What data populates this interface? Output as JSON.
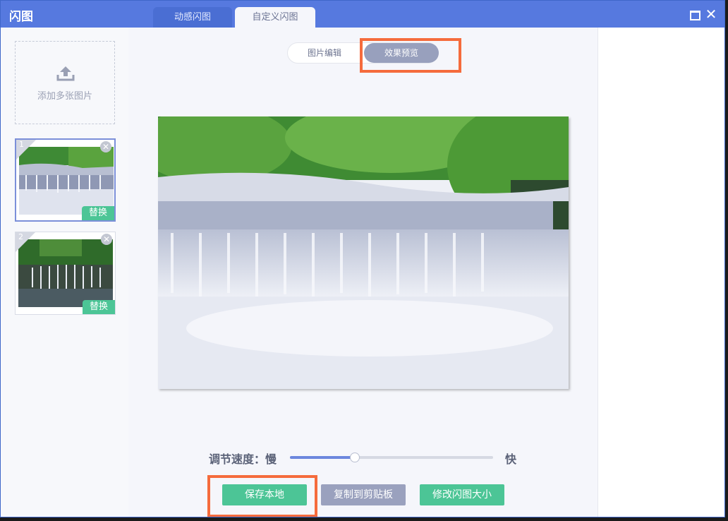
{
  "window": {
    "title": "闪图",
    "tabs": [
      {
        "label": "动感闪图",
        "active": false
      },
      {
        "label": "自定义闪图",
        "active": true
      }
    ]
  },
  "sidebar": {
    "add_label": "添加多张图片",
    "thumbnails": [
      {
        "number": "1",
        "replace_label": "替换",
        "selected": true
      },
      {
        "number": "2",
        "replace_label": "替换",
        "selected": false
      }
    ]
  },
  "mode": {
    "edit_label": "图片编辑",
    "preview_label": "效果预览",
    "active": "preview"
  },
  "speed": {
    "label": "调节速度：慢",
    "fast_label": "快",
    "value": 0.32
  },
  "actions": {
    "save_label": "保存本地",
    "copy_label": "复制到剪贴板",
    "resize_label": "修改闪图大小"
  },
  "colors": {
    "titlebar": "#5679df",
    "accent_green": "#4cc596",
    "accent_gray": "#9aa1be",
    "highlight": "#f56b3c"
  },
  "icons": {
    "upload": "upload-icon",
    "maximize": "maximize-icon",
    "close": "close-icon",
    "delete": "delete-icon"
  }
}
